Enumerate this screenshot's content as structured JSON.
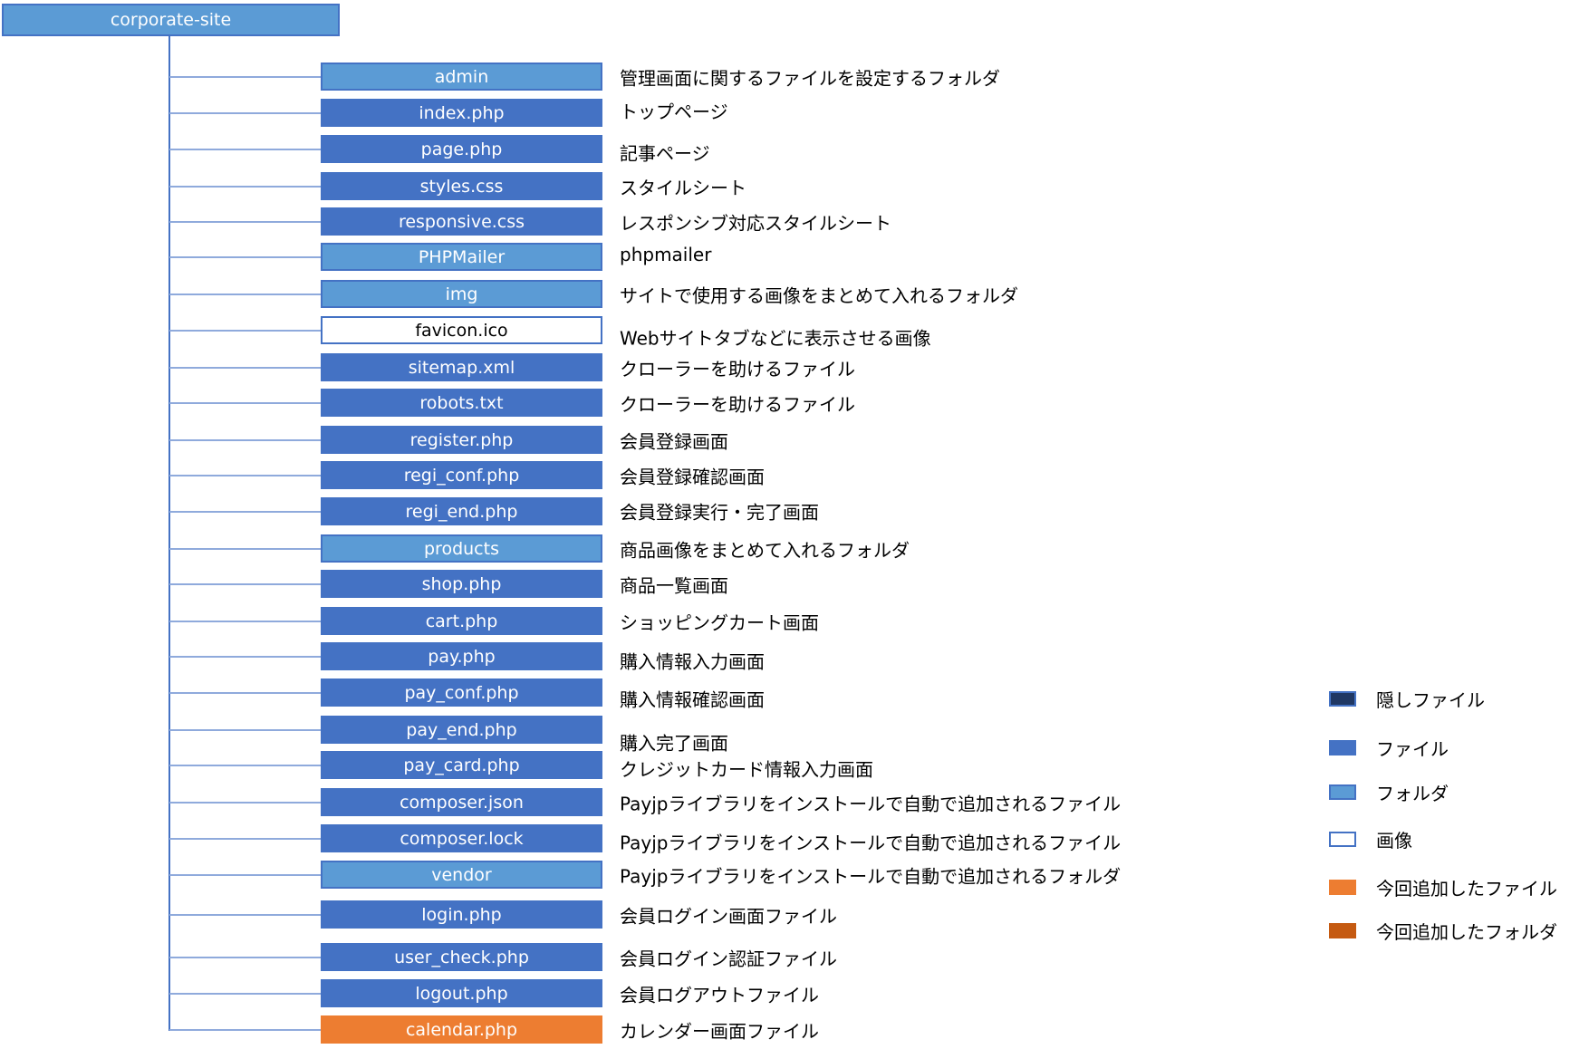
{
  "root": {
    "label": "corporate-site",
    "kind": "folder"
  },
  "colors": {
    "hidden_file": "#203864",
    "file": "#4472c4",
    "folder": "#5b9bd5",
    "image": "#ffffff",
    "added_file": "#ed7d31",
    "added_folder": "#c55a11",
    "border": "#4472c4"
  },
  "items": [
    {
      "name": "admin",
      "kind": "folder",
      "description": "管理画面に関するファイルを設定するフォルダ"
    },
    {
      "name": "index.php",
      "kind": "file",
      "description": "トップページ"
    },
    {
      "name": "page.php",
      "kind": "file",
      "description": "記事ページ"
    },
    {
      "name": "styles.css",
      "kind": "file",
      "description": "スタイルシート"
    },
    {
      "name": "responsive.css",
      "kind": "file",
      "description": "レスポンシブ対応スタイルシート"
    },
    {
      "name": "PHPMailer",
      "kind": "folder",
      "description": "phpmailer"
    },
    {
      "name": "img",
      "kind": "folder",
      "description": "サイトで使用する画像をまとめて入れるフォルダ"
    },
    {
      "name": "favicon.ico",
      "kind": "image",
      "description": "Webサイトタブなどに表示させる画像"
    },
    {
      "name": "sitemap.xml",
      "kind": "file",
      "description": "クローラーを助けるファイル"
    },
    {
      "name": "robots.txt",
      "kind": "file",
      "description": "クローラーを助けるファイル"
    },
    {
      "name": "register.php",
      "kind": "file",
      "description": "会員登録画面"
    },
    {
      "name": "regi_conf.php",
      "kind": "file",
      "description": "会員登録確認画面"
    },
    {
      "name": "regi_end.php",
      "kind": "file",
      "description": "会員登録実行・完了画面"
    },
    {
      "name": "products",
      "kind": "folder",
      "description": "商品画像をまとめて入れるフォルダ"
    },
    {
      "name": "shop.php",
      "kind": "file",
      "description": "商品一覧画面"
    },
    {
      "name": "cart.php",
      "kind": "file",
      "description": "ショッピングカート画面"
    },
    {
      "name": "pay.php",
      "kind": "file",
      "description": "購入情報入力画面"
    },
    {
      "name": "pay_conf.php",
      "kind": "file",
      "description": "購入情報確認画面"
    },
    {
      "name": "pay_end.php",
      "kind": "file",
      "description": "購入完了画面"
    },
    {
      "name": "pay_card.php",
      "kind": "file",
      "description": "クレジットカード情報入力画面"
    },
    {
      "name": "composer.json",
      "kind": "file",
      "description": "Payjpライブラリをインストールで自動で追加されるファイル"
    },
    {
      "name": "composer.lock",
      "kind": "file",
      "description": "Payjpライブラリをインストールで自動で追加されるファイル"
    },
    {
      "name": "vendor",
      "kind": "folder",
      "description": "Payjpライブラリをインストールで自動で追加されるフォルダ"
    },
    {
      "name": "login.php",
      "kind": "file",
      "description": "会員ログイン画面ファイル"
    },
    {
      "name": "user_check.php",
      "kind": "file",
      "description": "会員ログイン認証ファイル"
    },
    {
      "name": "logout.php",
      "kind": "file",
      "description": "会員ログアウトファイル"
    },
    {
      "name": "calendar.php",
      "kind": "added-file",
      "description": "カレンダー画面ファイル"
    }
  ],
  "legend": [
    {
      "kind": "hidden-file",
      "label": "隠しファイル"
    },
    {
      "kind": "file",
      "label": "ファイル"
    },
    {
      "kind": "folder",
      "label": "フォルダ"
    },
    {
      "kind": "image",
      "label": "画像"
    },
    {
      "kind": "added-file",
      "label": "今回追加したファイル"
    },
    {
      "kind": "added-folder",
      "label": "今回追加したフォルダ"
    }
  ]
}
